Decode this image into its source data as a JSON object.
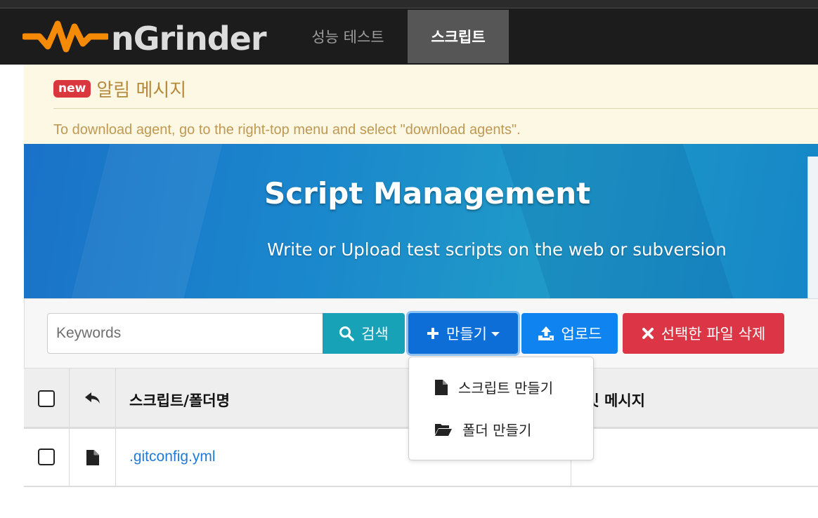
{
  "navbar": {
    "brand": "nGrinder",
    "tabs": [
      {
        "label": "성능 테스트",
        "active": false
      },
      {
        "label": "스크립트",
        "active": true
      }
    ]
  },
  "alert": {
    "badge": "new",
    "title": "알림 메시지",
    "message": "To download agent, go to the right-top menu and select \"download agents\"."
  },
  "banner": {
    "title": "Script Management",
    "subtitle": "Write or Upload test scripts on the web or subversion"
  },
  "toolbar": {
    "search_placeholder": "Keywords",
    "search_value": "",
    "search_label": "검색",
    "create_label": "만들기",
    "upload_label": "업로드",
    "delete_label": "선택한 파일 삭제"
  },
  "create_menu": {
    "items": [
      {
        "label": "스크립트 만들기",
        "icon": "file-icon"
      },
      {
        "label": "폴더 만들기",
        "icon": "folder-open-icon"
      }
    ]
  },
  "table": {
    "headers": {
      "name": "스크립트/폴더명",
      "commit_partial": "커밋 메시지"
    },
    "rows": [
      {
        "name": ".gitconfig.yml",
        "type": "file",
        "commit": ""
      }
    ]
  },
  "colors": {
    "navbar_bg": "#1c1c1c",
    "active_tab_bg": "#565656",
    "alert_bg": "#fcf8e3",
    "search_button": "#17a2b8",
    "create_button": "#0d6ed8",
    "upload_button": "#0f84f0",
    "delete_button": "#dc3545",
    "link": "#1f7ad8"
  }
}
